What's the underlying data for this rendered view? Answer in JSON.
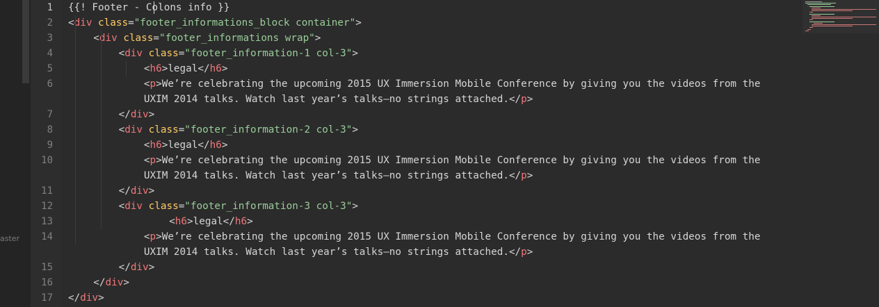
{
  "sidebar": {
    "branch_label": "aster"
  },
  "editor": {
    "active_line": "1",
    "lines": [
      {
        "no": "1",
        "indent": 0,
        "parts": [
          [
            "cmt",
            "{{! Footer - Colons info }}"
          ]
        ]
      },
      {
        "no": "2",
        "indent": 0,
        "parts": [
          [
            "punct",
            "<"
          ],
          [
            "tag",
            "div"
          ],
          [
            "punct",
            " "
          ],
          [
            "attr",
            "class"
          ],
          [
            "punct",
            "="
          ],
          [
            "str",
            "\"footer_informations_block container\""
          ],
          [
            "punct",
            ">"
          ]
        ]
      },
      {
        "no": "3",
        "indent": 1,
        "parts": [
          [
            "punct",
            "<"
          ],
          [
            "tag",
            "div"
          ],
          [
            "punct",
            " "
          ],
          [
            "attr",
            "class"
          ],
          [
            "punct",
            "="
          ],
          [
            "str",
            "\"footer_informations wrap\""
          ],
          [
            "punct",
            ">"
          ]
        ]
      },
      {
        "no": "4",
        "indent": 2,
        "parts": [
          [
            "punct",
            "<"
          ],
          [
            "tag",
            "div"
          ],
          [
            "punct",
            " "
          ],
          [
            "attr",
            "class"
          ],
          [
            "punct",
            "="
          ],
          [
            "str",
            "\"footer_information-1 col-3\""
          ],
          [
            "punct",
            ">"
          ]
        ]
      },
      {
        "no": "5",
        "indent": 3,
        "parts": [
          [
            "punct",
            "<"
          ],
          [
            "tag",
            "h6"
          ],
          [
            "punct",
            ">"
          ],
          [
            "txt",
            "legal"
          ],
          [
            "punct",
            "</"
          ],
          [
            "tag",
            "h6"
          ],
          [
            "punct",
            ">"
          ]
        ]
      },
      {
        "no": "6",
        "indent": 3,
        "parts": [
          [
            "punct",
            "<"
          ],
          [
            "tag",
            "p"
          ],
          [
            "punct",
            ">"
          ],
          [
            "txt",
            "We’re celebrating the upcoming 2015 UX Immersion Mobile Conference by giving you the videos from the"
          ]
        ]
      },
      {
        "no": "",
        "indent": 3,
        "parts": [
          [
            "txt",
            "UXIM 2014 talks. Watch last year’s talks—no strings attached."
          ],
          [
            "punct",
            "</"
          ],
          [
            "tag",
            "p"
          ],
          [
            "punct",
            ">"
          ]
        ]
      },
      {
        "no": "7",
        "indent": 2,
        "parts": [
          [
            "punct",
            "</"
          ],
          [
            "tag",
            "div"
          ],
          [
            "punct",
            ">"
          ]
        ]
      },
      {
        "no": "8",
        "indent": 2,
        "parts": [
          [
            "punct",
            "<"
          ],
          [
            "tag",
            "div"
          ],
          [
            "punct",
            " "
          ],
          [
            "attr",
            "class"
          ],
          [
            "punct",
            "="
          ],
          [
            "str",
            "\"footer_information-2 col-3\""
          ],
          [
            "punct",
            ">"
          ]
        ]
      },
      {
        "no": "9",
        "indent": 3,
        "parts": [
          [
            "punct",
            "<"
          ],
          [
            "tag",
            "h6"
          ],
          [
            "punct",
            ">"
          ],
          [
            "txt",
            "legal"
          ],
          [
            "punct",
            "</"
          ],
          [
            "tag",
            "h6"
          ],
          [
            "punct",
            ">"
          ]
        ]
      },
      {
        "no": "10",
        "indent": 3,
        "parts": [
          [
            "punct",
            "<"
          ],
          [
            "tag",
            "p"
          ],
          [
            "punct",
            ">"
          ],
          [
            "txt",
            "We’re celebrating the upcoming 2015 UX Immersion Mobile Conference by giving you the videos from the"
          ]
        ]
      },
      {
        "no": "",
        "indent": 3,
        "parts": [
          [
            "txt",
            "UXIM 2014 talks. Watch last year’s talks—no strings attached."
          ],
          [
            "punct",
            "</"
          ],
          [
            "tag",
            "p"
          ],
          [
            "punct",
            ">"
          ]
        ]
      },
      {
        "no": "11",
        "indent": 2,
        "parts": [
          [
            "punct",
            "</"
          ],
          [
            "tag",
            "div"
          ],
          [
            "punct",
            ">"
          ]
        ]
      },
      {
        "no": "12",
        "indent": 2,
        "parts": [
          [
            "punct",
            "<"
          ],
          [
            "tag",
            "div"
          ],
          [
            "punct",
            " "
          ],
          [
            "attr",
            "class"
          ],
          [
            "punct",
            "="
          ],
          [
            "str",
            "\"footer_information-3 col-3\""
          ],
          [
            "punct",
            ">"
          ]
        ]
      },
      {
        "no": "13",
        "indent": 4,
        "parts": [
          [
            "punct",
            "<"
          ],
          [
            "tag",
            "h6"
          ],
          [
            "punct",
            ">"
          ],
          [
            "txt",
            "legal"
          ],
          [
            "punct",
            "</"
          ],
          [
            "tag",
            "h6"
          ],
          [
            "punct",
            ">"
          ]
        ]
      },
      {
        "no": "14",
        "indent": 3,
        "parts": [
          [
            "punct",
            "<"
          ],
          [
            "tag",
            "p"
          ],
          [
            "punct",
            ">"
          ],
          [
            "txt",
            "We’re celebrating the upcoming 2015 UX Immersion Mobile Conference by giving you the videos from the"
          ]
        ]
      },
      {
        "no": "",
        "indent": 3,
        "parts": [
          [
            "txt",
            "UXIM 2014 talks. Watch last year’s talks—no strings attached."
          ],
          [
            "punct",
            "</"
          ],
          [
            "tag",
            "p"
          ],
          [
            "punct",
            ">"
          ]
        ]
      },
      {
        "no": "15",
        "indent": 2,
        "parts": [
          [
            "punct",
            "</"
          ],
          [
            "tag",
            "div"
          ],
          [
            "punct",
            ">"
          ]
        ]
      },
      {
        "no": "16",
        "indent": 1,
        "parts": [
          [
            "punct",
            "</"
          ],
          [
            "tag",
            "div"
          ],
          [
            "punct",
            ">"
          ]
        ]
      },
      {
        "no": "17",
        "indent": 0,
        "parts": [
          [
            "punct",
            "</"
          ],
          [
            "tag",
            "div"
          ],
          [
            "punct",
            ">"
          ]
        ]
      }
    ]
  },
  "theme": {
    "background": "#2b2b2b",
    "tag": "#f2777a",
    "attribute": "#ffcc66",
    "string": "#99cc99",
    "text": "#d6d6d6",
    "line_number": "#808080"
  }
}
